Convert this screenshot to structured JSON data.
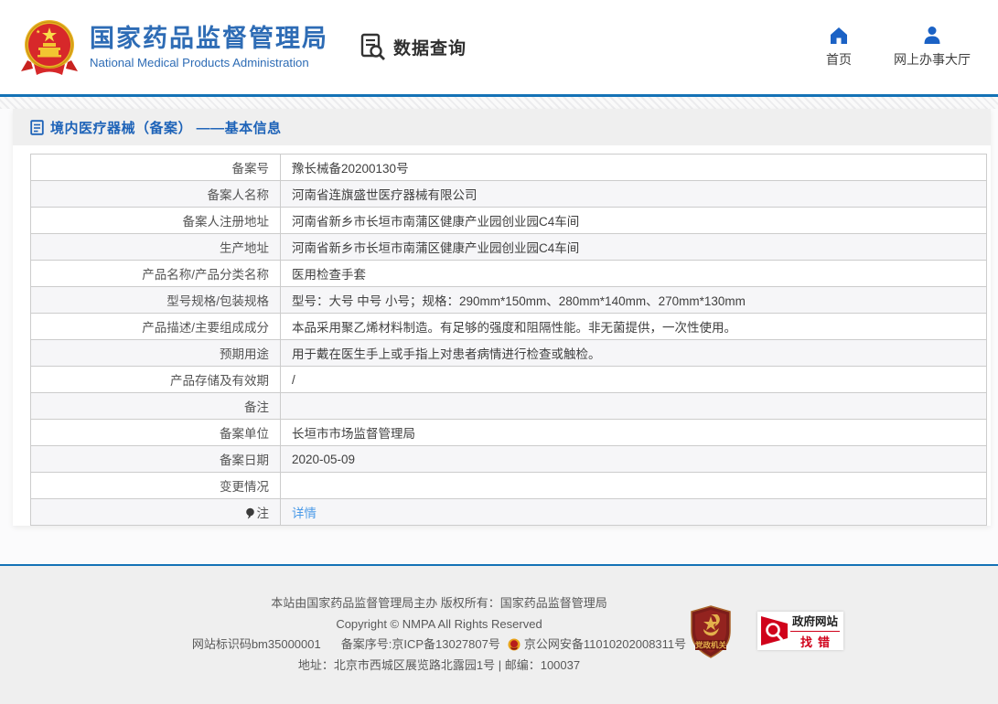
{
  "header": {
    "org_name_cn": "国家药品监督管理局",
    "org_name_en": "National Medical Products Administration",
    "data_query_label": "数据查询",
    "nav": [
      {
        "label": "首页",
        "icon": "home-icon"
      },
      {
        "label": "网上办事大厅",
        "icon": "user-icon"
      }
    ]
  },
  "content": {
    "title": "境内医疗器械（备案） ——基本信息",
    "rows": [
      {
        "label": "备案号",
        "value": "豫长械备20200130号"
      },
      {
        "label": "备案人名称",
        "value": "河南省连旗盛世医疗器械有限公司"
      },
      {
        "label": "备案人注册地址",
        "value": "河南省新乡市长垣市南蒲区健康产业园创业园C4车间"
      },
      {
        "label": "生产地址",
        "value": "河南省新乡市长垣市南蒲区健康产业园创业园C4车间"
      },
      {
        "label": "产品名称/产品分类名称",
        "value": "医用检查手套"
      },
      {
        "label": "型号规格/包装规格",
        "value": "型号：大号 中号 小号；规格：290mm*150mm、280mm*140mm、270mm*130mm"
      },
      {
        "label": "产品描述/主要组成成分",
        "value": "本品采用聚乙烯材料制造。有足够的强度和阻隔性能。非无菌提供，一次性使用。"
      },
      {
        "label": "预期用途",
        "value": "用于戴在医生手上或手指上对患者病情进行检查或触检。"
      },
      {
        "label": "产品存储及有效期",
        "value": "/"
      },
      {
        "label": "备注",
        "value": ""
      },
      {
        "label": "备案单位",
        "value": "长垣市市场监督管理局"
      },
      {
        "label": "备案日期",
        "value": "2020-05-09"
      },
      {
        "label": "变更情况",
        "value": ""
      },
      {
        "label": "注",
        "value": "详情",
        "link": true,
        "label_icon": "balloon-icon"
      }
    ]
  },
  "footer": {
    "line1": "本站由国家药品监督管理局主办 版权所有：国家药品监督管理局",
    "line2": "Copyright © NMPA All Rights Reserved",
    "line3_items": [
      "网站标识码bm35000001",
      "备案序号:京ICP备13027807号",
      "京公网安备11010202008311号"
    ],
    "line4": "地址：北京市西城区展览路北露园1号 | 邮编：100037",
    "badges": {
      "party_shield": "党政机关",
      "gov_site": "政府网站",
      "find_error": "找错"
    }
  },
  "colors": {
    "accent_blue": "#1472b6",
    "org_blue": "#2e6cb5",
    "nav_icon_blue": "#1b62c5",
    "title_blue": "#1e63b8",
    "link_blue": "#4a9ae8",
    "footer_bg": "#efefef",
    "badge_red": "#d0021b",
    "table_border": "#cccccc",
    "row_stripe": "#f6f6f8"
  }
}
